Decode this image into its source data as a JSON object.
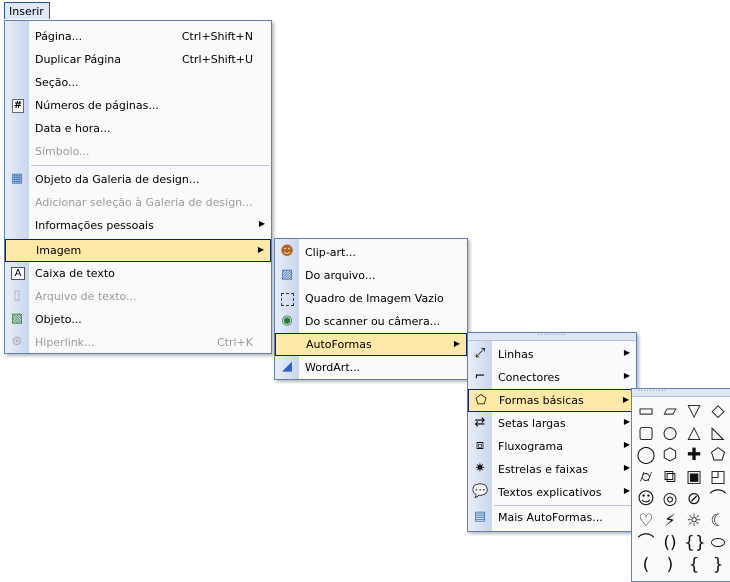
{
  "menubar": {
    "title": "Inserir"
  },
  "menu_inserir": {
    "items": [
      {
        "label": "Página...",
        "shortcut": "Ctrl+Shift+N"
      },
      {
        "label": "Duplicar Página",
        "shortcut": "Ctrl+Shift+U"
      },
      {
        "label": "Seção..."
      },
      {
        "label": "Números de páginas...",
        "icon": "page-number-icon"
      },
      {
        "label": "Data e hora..."
      },
      {
        "label": "Símbolo..."
      },
      {
        "label": "Objeto da Galeria de design...",
        "icon": "design-gallery-icon"
      },
      {
        "label": "Adicionar seleção à Galeria de design..."
      },
      {
        "label": "Informações pessoais"
      },
      {
        "label": "Imagem"
      },
      {
        "label": "Caixa de texto",
        "icon": "text-box-icon"
      },
      {
        "label": "Arquivo de texto...",
        "icon": "text-file-icon"
      },
      {
        "label": "Objeto...",
        "icon": "object-icon"
      },
      {
        "label": "Hiperlink...",
        "shortcut": "Ctrl+K",
        "icon": "hyperlink-icon"
      }
    ]
  },
  "menu_imagem": {
    "items": [
      {
        "label": "Clip-art...",
        "icon": "clip-art-icon"
      },
      {
        "label": "Do arquivo...",
        "icon": "from-file-icon"
      },
      {
        "label": "Quadro de Imagem Vazio",
        "icon": "empty-frame-icon"
      },
      {
        "label": "Do scanner ou câmera...",
        "icon": "scanner-icon"
      },
      {
        "label": "AutoFormas"
      },
      {
        "label": "WordArt...",
        "icon": "wordart-icon"
      }
    ]
  },
  "menu_autoformas": {
    "items": [
      {
        "label": "Linhas",
        "icon": "lines-icon"
      },
      {
        "label": "Conectores",
        "icon": "connectors-icon"
      },
      {
        "label": "Formas básicas",
        "icon": "basic-shapes-icon"
      },
      {
        "label": "Setas largas",
        "icon": "block-arrows-icon"
      },
      {
        "label": "Fluxograma",
        "icon": "flowchart-icon"
      },
      {
        "label": "Estrelas e faixas",
        "icon": "stars-banners-icon"
      },
      {
        "label": "Textos explicativos",
        "icon": "callouts-icon"
      },
      {
        "label": "Mais AutoFormas...",
        "icon": "more-autoshapes-icon"
      }
    ]
  },
  "palette": {
    "grip": "··········",
    "shapes": [
      {
        "name": "rectangle-shape",
        "glyph": "▭"
      },
      {
        "name": "parallelogram-shape",
        "glyph": "▱"
      },
      {
        "name": "trapezoid-shape",
        "glyph": "▽"
      },
      {
        "name": "diamond-shape",
        "glyph": "◇"
      },
      {
        "name": "rounded-rectangle-shape",
        "glyph": "▢"
      },
      {
        "name": "octagon-shape",
        "glyph": "○"
      },
      {
        "name": "triangle-shape",
        "glyph": "△"
      },
      {
        "name": "right-triangle-shape",
        "glyph": "◺"
      },
      {
        "name": "oval-shape",
        "glyph": "◯"
      },
      {
        "name": "hexagon-shape",
        "glyph": "⬡"
      },
      {
        "name": "cross-shape",
        "glyph": "✚"
      },
      {
        "name": "pentagon-shape",
        "glyph": "⬠"
      },
      {
        "name": "can-shape",
        "glyph": "⌭"
      },
      {
        "name": "cube-shape",
        "glyph": "⧉"
      },
      {
        "name": "bevel-shape",
        "glyph": "▣"
      },
      {
        "name": "folded-corner-shape",
        "glyph": "◰"
      },
      {
        "name": "smiley-shape",
        "glyph": "☺"
      },
      {
        "name": "donut-shape",
        "glyph": "◎"
      },
      {
        "name": "no-symbol-shape",
        "glyph": "⊘"
      },
      {
        "name": "arc-shape",
        "glyph": "⌒"
      },
      {
        "name": "heart-shape",
        "glyph": "♡"
      },
      {
        "name": "lightning-shape",
        "glyph": "⚡"
      },
      {
        "name": "sun-shape",
        "glyph": "☼"
      },
      {
        "name": "moon-shape",
        "glyph": "☾"
      },
      {
        "name": "arc-line-shape",
        "glyph": "⌒"
      },
      {
        "name": "double-bracket-shape",
        "glyph": "()"
      },
      {
        "name": "double-brace-shape",
        "glyph": "{}"
      },
      {
        "name": "plaque-shape",
        "glyph": "⬭"
      },
      {
        "name": "left-bracket-shape",
        "glyph": "("
      },
      {
        "name": "right-bracket-shape",
        "glyph": ")"
      },
      {
        "name": "left-brace-shape",
        "glyph": "{"
      },
      {
        "name": "right-brace-shape",
        "glyph": "}"
      }
    ]
  }
}
